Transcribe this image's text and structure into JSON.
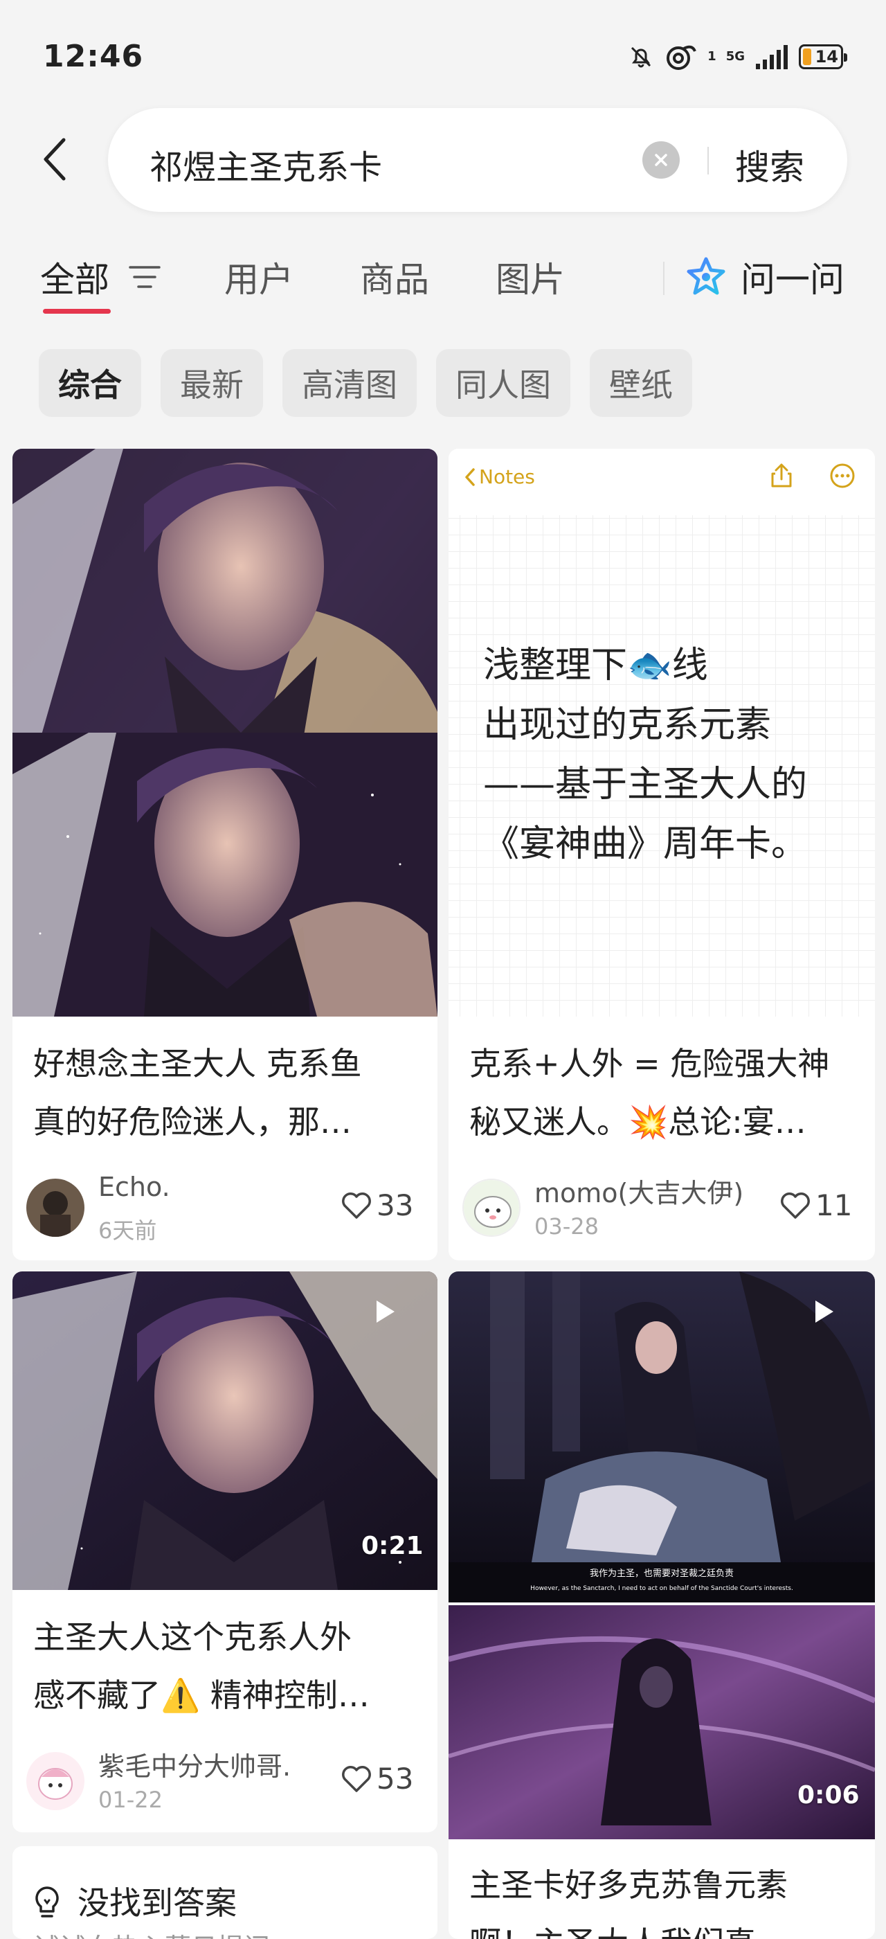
{
  "status": {
    "time": "12:46",
    "network": "5G",
    "sim": "1",
    "battery": "14"
  },
  "search": {
    "query": "祁煜主圣克系卡",
    "button": "搜索"
  },
  "tabs": {
    "items": [
      "全部",
      "用户",
      "商品",
      "图片"
    ],
    "active": "全部",
    "ask": "问一问"
  },
  "chips": {
    "items": [
      "综合",
      "最新",
      "高清图",
      "同人图",
      "壁纸"
    ],
    "active": "综合"
  },
  "notes_image": {
    "back": "Notes",
    "lines": [
      "浅整理下🐟线",
      "出现过的克系元素",
      "——基于主圣大人的",
      "《宴神曲》周年卡。"
    ]
  },
  "video_caption": {
    "cn": "我作为主圣，也需要对圣裁之廷负责",
    "en": "However, as the Sanctarch, I need to act on behalf of the Sanctide Court's interests."
  },
  "cards": [
    {
      "title_lines": [
        "好想念主圣大人 克系鱼",
        "真的好危险迷人，那…"
      ],
      "author": "Echo.",
      "date": "6天前",
      "likes": "33"
    },
    {
      "title_lines": [
        "克系+人外 = 危险强大神",
        "秘又迷人。💥总论:宴…"
      ],
      "author": "momo(大吉大伊)",
      "date": "03-28",
      "likes": "11"
    },
    {
      "title_lines": [
        "主圣大人这个克系人外",
        "感不藏了⚠️ 精神控制…"
      ],
      "author": "紫毛中分大帅哥.",
      "date": "01-22",
      "likes": "53",
      "duration": "0:21"
    },
    {
      "title_lines": [
        "主圣卡好多克苏鲁元素",
        "啊！主圣大人我们真…"
      ],
      "duration": "0:06"
    }
  ],
  "no_answer": {
    "title": "没找到答案",
    "subtitle": "试试向热心薯日提问"
  }
}
